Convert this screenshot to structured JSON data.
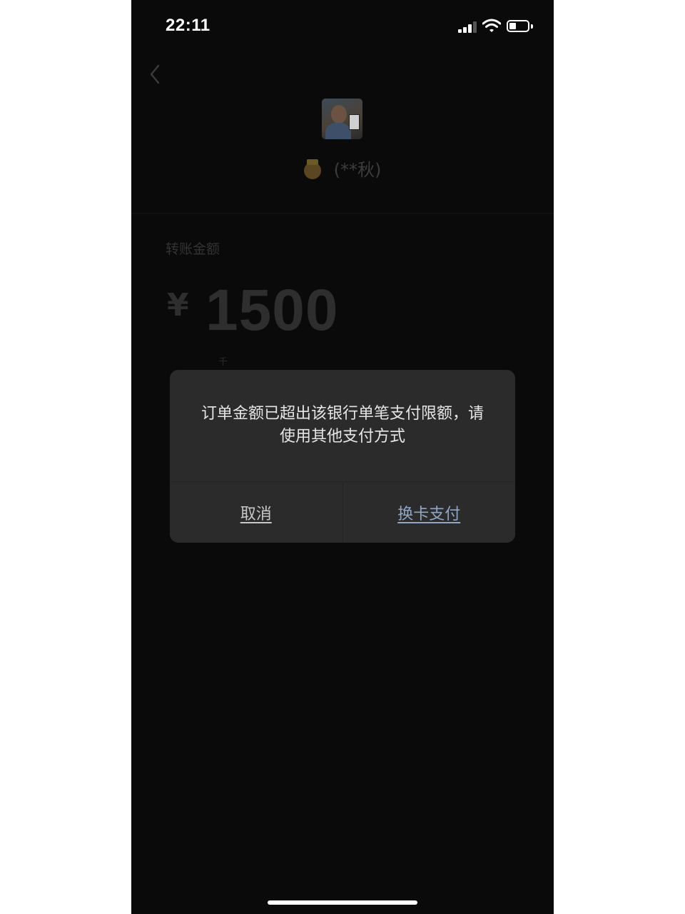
{
  "status_bar": {
    "time": "22:11",
    "icons": [
      "signal-icon",
      "wifi-icon",
      "battery-icon"
    ]
  },
  "header": {
    "back_icon": "chevron-left-icon",
    "recipient_name": "(**秋)",
    "badge_icon": "emoji-badge-icon"
  },
  "transfer": {
    "amount_label": "转账金额",
    "currency_symbol": "¥",
    "amount": "1500",
    "unit_hint": "千"
  },
  "dialog": {
    "message": "订单金额已超出该银行单笔支付限额，请使用其他支付方式",
    "cancel_label": "取消",
    "confirm_label": "换卡支付"
  },
  "colors": {
    "screen_bg": "#0a0a0a",
    "dialog_bg": "#2b2b2b",
    "confirm_text": "#8fa6c4",
    "cancel_text": "#c8c8c8"
  }
}
